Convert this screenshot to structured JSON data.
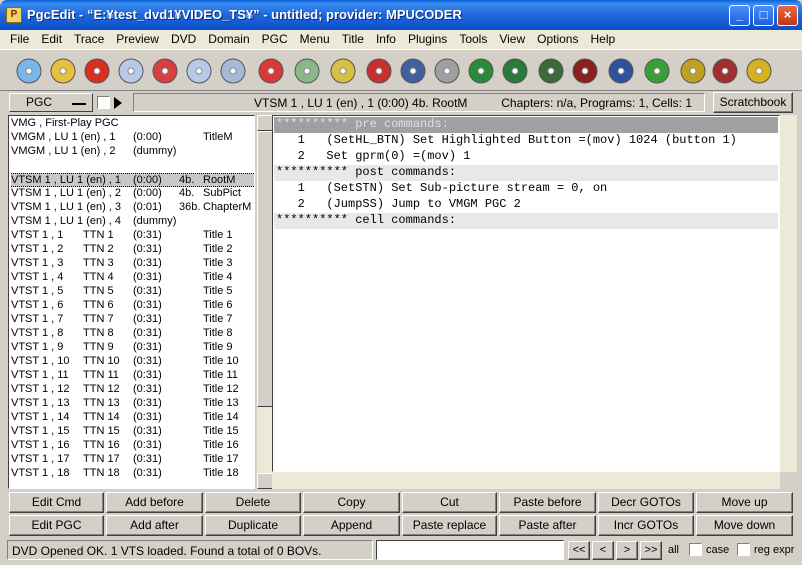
{
  "window": {
    "title": "PgcEdit - “E:¥test_dvd1¥VIDEO_TS¥” - untitled; provider: MPUCODER",
    "app_icon_glyph": "P",
    "minimize": "_",
    "maximize": "□",
    "close": "×"
  },
  "menu": [
    "File",
    "Edit",
    "Trace",
    "Preview",
    "DVD",
    "Domain",
    "PGC",
    "Menu",
    "Title",
    "Info",
    "Plugins",
    "Tools",
    "View",
    "Options",
    "Help"
  ],
  "toolbar_icons": [
    "disc-icon",
    "open-folder-icon",
    "undo-icon",
    "new-disc-icon",
    "burn-icon",
    "search-disc-icon",
    "disc-pair-icon",
    "disc-remove-icon",
    "blank-pages-icon",
    "open-folder-icon",
    "check-disc-icon",
    "id-disc-icon",
    "copy-pages-icon",
    "globe-icon",
    "play-film-icon",
    "settings-gear-icon",
    "list-numbered-icon",
    "film-cross-icon",
    "menu-green-icon",
    "chain-icon",
    "grid-icon",
    "tcl-icon"
  ],
  "pgc_bar": {
    "pgc_label": "PGC",
    "info_vtsm": "VTSM 1 , LU 1 (en) , 1  (0:00)  4b.  RootM",
    "info_chapters": "Chapters: n/a,  Programs: 1,  Cells: 1",
    "scratchbook": "Scratchbook"
  },
  "pgc_list": [
    {
      "c1": "VMG , First-Play PGC",
      "c2": "",
      "c3": "",
      "c4": "",
      "c5": ""
    },
    {
      "c1": "VMGM , LU 1 (en) , 1",
      "c2": "",
      "c3": "(0:00)",
      "c4": "",
      "c5": "TitleM"
    },
    {
      "c1": "VMGM , LU 1 (en) , 2",
      "c2": "",
      "c3": "(dummy)",
      "c4": "",
      "c5": ""
    },
    {
      "c1": "",
      "c2": "",
      "c3": "",
      "c4": "",
      "c5": ""
    },
    {
      "c1": "VTSM 1 , LU 1 (en) , 1",
      "c2": "",
      "c3": "(0:00)",
      "c4": "4b.",
      "c5": "RootM"
    },
    {
      "c1": "VTSM 1 , LU 1 (en) , 2",
      "c2": "",
      "c3": "(0:00)",
      "c4": "4b.",
      "c5": "SubPict"
    },
    {
      "c1": "VTSM 1 , LU 1 (en) , 3",
      "c2": "",
      "c3": "(0:01)",
      "c4": "36b.",
      "c5": "ChapterM"
    },
    {
      "c1": "VTSM 1 , LU 1 (en) , 4",
      "c2": "",
      "c3": "(dummy)",
      "c4": "",
      "c5": ""
    },
    {
      "c1": "VTST 1 , 1",
      "c2": "TTN 1",
      "c3": "(0:31)",
      "c4": "",
      "c5": "Title 1"
    },
    {
      "c1": "VTST 1 , 2",
      "c2": "TTN 2",
      "c3": "(0:31)",
      "c4": "",
      "c5": "Title 2"
    },
    {
      "c1": "VTST 1 , 3",
      "c2": "TTN 3",
      "c3": "(0:31)",
      "c4": "",
      "c5": "Title 3"
    },
    {
      "c1": "VTST 1 , 4",
      "c2": "TTN 4",
      "c3": "(0:31)",
      "c4": "",
      "c5": "Title 4"
    },
    {
      "c1": "VTST 1 , 5",
      "c2": "TTN 5",
      "c3": "(0:31)",
      "c4": "",
      "c5": "Title 5"
    },
    {
      "c1": "VTST 1 , 6",
      "c2": "TTN 6",
      "c3": "(0:31)",
      "c4": "",
      "c5": "Title 6"
    },
    {
      "c1": "VTST 1 , 7",
      "c2": "TTN 7",
      "c3": "(0:31)",
      "c4": "",
      "c5": "Title 7"
    },
    {
      "c1": "VTST 1 , 8",
      "c2": "TTN 8",
      "c3": "(0:31)",
      "c4": "",
      "c5": "Title 8"
    },
    {
      "c1": "VTST 1 , 9",
      "c2": "TTN 9",
      "c3": "(0:31)",
      "c4": "",
      "c5": "Title 9"
    },
    {
      "c1": "VTST 1 , 10",
      "c2": "TTN 10",
      "c3": "(0:31)",
      "c4": "",
      "c5": "Title 10"
    },
    {
      "c1": "VTST 1 , 11",
      "c2": "TTN 11",
      "c3": "(0:31)",
      "c4": "",
      "c5": "Title 11"
    },
    {
      "c1": "VTST 1 , 12",
      "c2": "TTN 12",
      "c3": "(0:31)",
      "c4": "",
      "c5": "Title 12"
    },
    {
      "c1": "VTST 1 , 13",
      "c2": "TTN 13",
      "c3": "(0:31)",
      "c4": "",
      "c5": "Title 13"
    },
    {
      "c1": "VTST 1 , 14",
      "c2": "TTN 14",
      "c3": "(0:31)",
      "c4": "",
      "c5": "Title 14"
    },
    {
      "c1": "VTST 1 , 15",
      "c2": "TTN 15",
      "c3": "(0:31)",
      "c4": "",
      "c5": "Title 15"
    },
    {
      "c1": "VTST 1 , 16",
      "c2": "TTN 16",
      "c3": "(0:31)",
      "c4": "",
      "c5": "Title 16"
    },
    {
      "c1": "VTST 1 , 17",
      "c2": "TTN 17",
      "c3": "(0:31)",
      "c4": "",
      "c5": "Title 17"
    },
    {
      "c1": "VTST 1 , 18",
      "c2": "TTN 18",
      "c3": "(0:31)",
      "c4": "",
      "c5": "Title 18"
    }
  ],
  "selected_row_index": 4,
  "commands": [
    {
      "kind": "hdr-sel",
      "text": "********** pre commands:"
    },
    {
      "kind": "cmd",
      "text": "   1   (SetHL_BTN) Set Highlighted Button =(mov) 1024 (button 1)"
    },
    {
      "kind": "cmd",
      "text": "   2   Set gprm(0) =(mov) 1"
    },
    {
      "kind": "hdr",
      "text": "********** post commands:"
    },
    {
      "kind": "cmd",
      "text": "   1   (SetSTN) Set Sub-picture stream = 0, on"
    },
    {
      "kind": "cmd",
      "text": "   2   (JumpSS) Jump to VMGM PGC 2"
    },
    {
      "kind": "hdr",
      "text": "********** cell commands:"
    }
  ],
  "buttons_row1": [
    "Edit Cmd",
    "Add before",
    "Delete",
    "Copy",
    "Cut",
    "Paste before",
    "Decr GOTOs",
    "Move up"
  ],
  "buttons_row2": [
    "Edit PGC",
    "Add after",
    "Duplicate",
    "Append",
    "Paste replace",
    "Paste after",
    "Incr GOTOs",
    "Move down"
  ],
  "status": {
    "message": "DVD Opened OK.  1 VTS loaded.   Found a total of 0 BOVs.",
    "search_value": "",
    "nav": [
      "<<",
      "<",
      ">",
      ">>"
    ],
    "all_label": "all",
    "case_label": "case",
    "regexpr_label": "reg expr"
  }
}
